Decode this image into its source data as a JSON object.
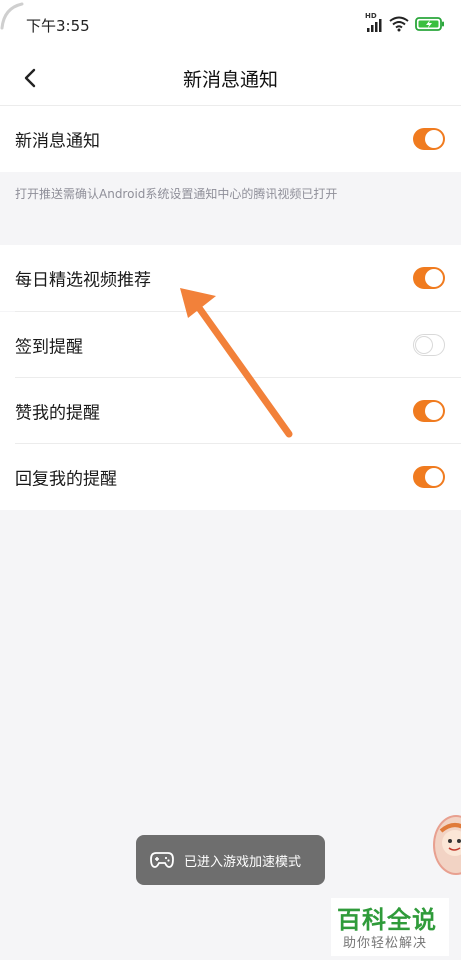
{
  "status_bar": {
    "time": "下午3:55",
    "hd_label": "HD",
    "battery_color": "#3bbf3f"
  },
  "nav": {
    "title": "新消息通知",
    "back_icon": "chevron-left-icon"
  },
  "main_setting": {
    "label": "新消息通知",
    "enabled": true
  },
  "hint": "打开推送需确认Android系统设置通知中心的腾讯视频已打开",
  "settings": [
    {
      "label": "每日精选视频推荐",
      "enabled": true
    },
    {
      "label": "签到提醒",
      "enabled": false
    },
    {
      "label": "赞我的提醒",
      "enabled": true
    },
    {
      "label": "回复我的提醒",
      "enabled": true
    }
  ],
  "toast": {
    "icon": "gamepad-icon",
    "text": "已进入游戏加速模式"
  },
  "watermark": {
    "title": "百科全说",
    "subtitle": "助你轻松解决"
  },
  "colors": {
    "accent": "#f07b1f",
    "arrow": "#f2813a",
    "background": "#f5f5f7"
  }
}
